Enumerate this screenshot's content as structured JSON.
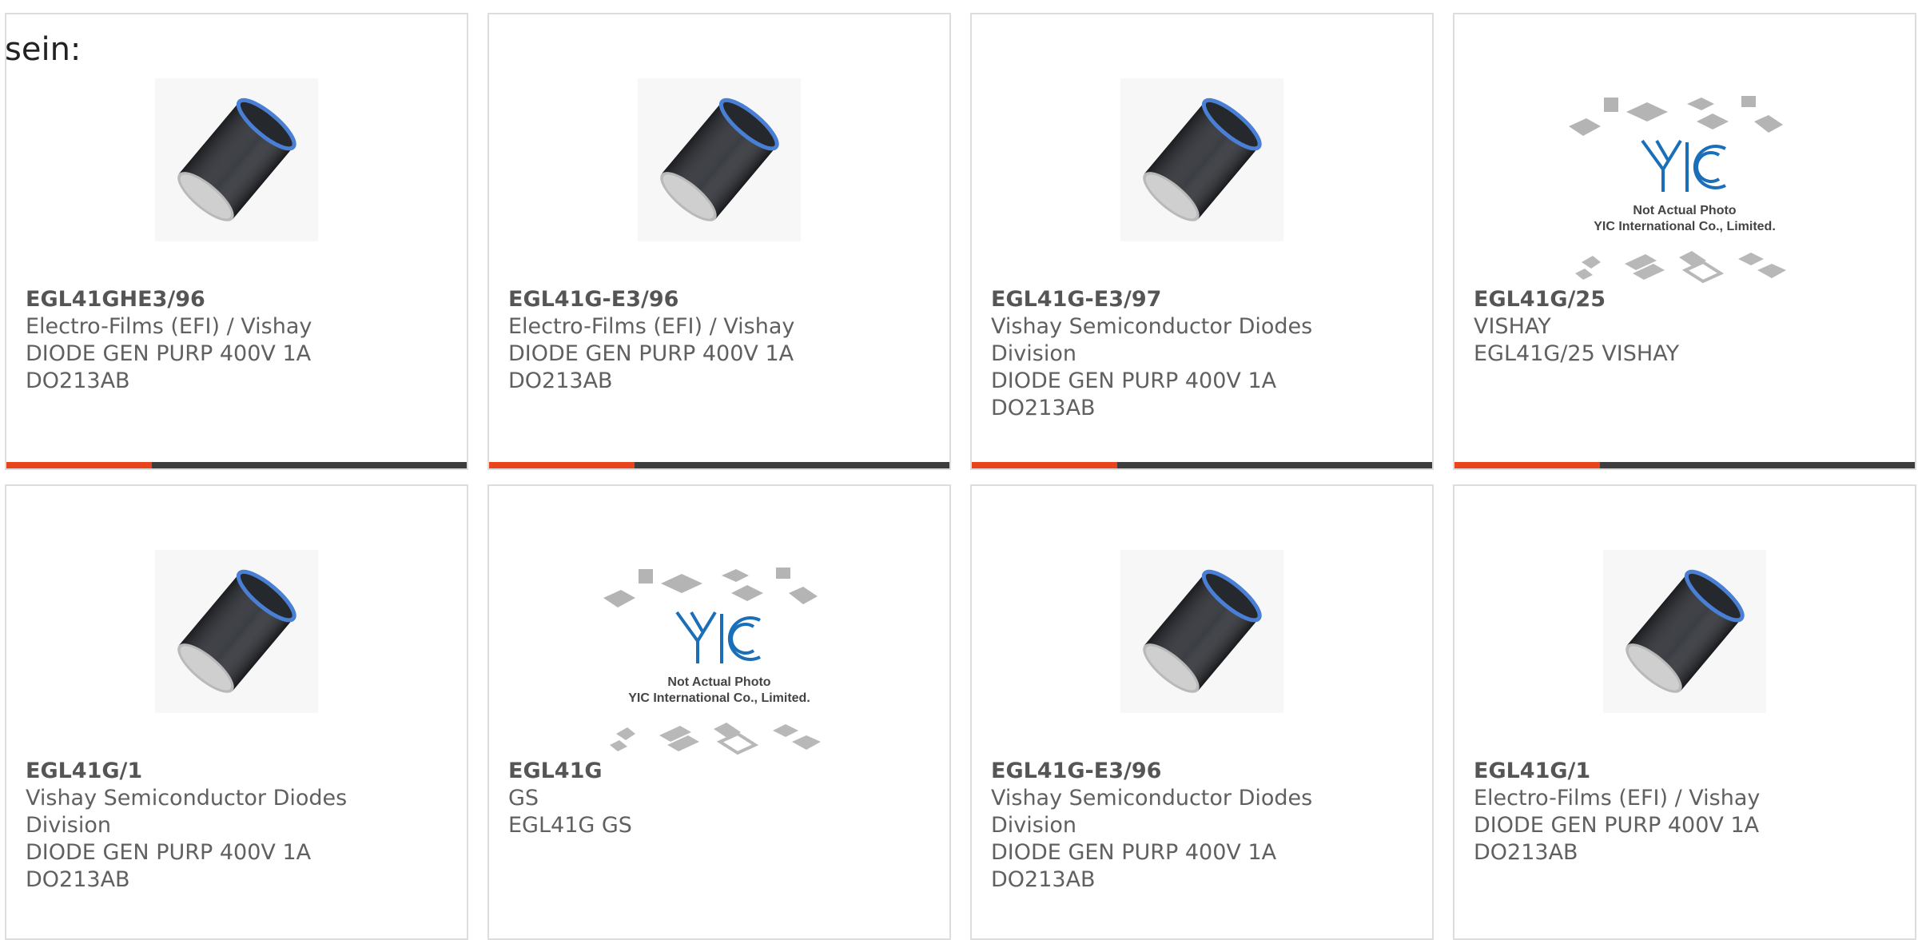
{
  "intro_text": "sein:",
  "colors": {
    "accent": "#e8451f",
    "bar_dark": "#3d3d3d",
    "yic_blue": "#1a6fb8"
  },
  "products": [
    {
      "part": "EGL41GHE3/96",
      "image": "diode-photo",
      "lines": [
        "Electro-Films (EFI) / Vishay",
        "DIODE GEN PURP 400V 1A",
        "DO213AB"
      ]
    },
    {
      "part": "EGL41G-E3/96",
      "image": "diode-photo",
      "lines": [
        "Electro-Films (EFI) / Vishay",
        "DIODE GEN PURP 400V 1A",
        "DO213AB"
      ]
    },
    {
      "part": "EGL41G-E3/97",
      "image": "diode-photo",
      "lines": [
        "Vishay Semiconductor Diodes",
        "Division",
        "DIODE GEN PURP 400V 1A",
        "DO213AB"
      ]
    },
    {
      "part": "EGL41G/25",
      "image": "yic-placeholder",
      "lines": [
        "VISHAY",
        "EGL41G/25 VISHAY"
      ]
    },
    {
      "part": "EGL41G/1",
      "image": "diode-photo",
      "lines": [
        "Vishay Semiconductor Diodes",
        "Division",
        "DIODE GEN PURP 400V 1A",
        "DO213AB"
      ]
    },
    {
      "part": "EGL41G",
      "image": "yic-placeholder",
      "lines": [
        "GS",
        "EGL41G GS"
      ]
    },
    {
      "part": "EGL41G-E3/96",
      "image": "diode-photo",
      "lines": [
        "Vishay Semiconductor Diodes",
        "Division",
        "DIODE GEN PURP 400V 1A",
        "DO213AB"
      ]
    },
    {
      "part": "EGL41G/1",
      "image": "diode-photo",
      "lines": [
        "Electro-Films (EFI) / Vishay",
        "DIODE GEN PURP 400V 1A",
        "DO213AB"
      ]
    }
  ],
  "yic_placeholder": {
    "title": "Not Actual Photo",
    "company": "YIC International Co., Limited.",
    "logo": "YIC"
  }
}
